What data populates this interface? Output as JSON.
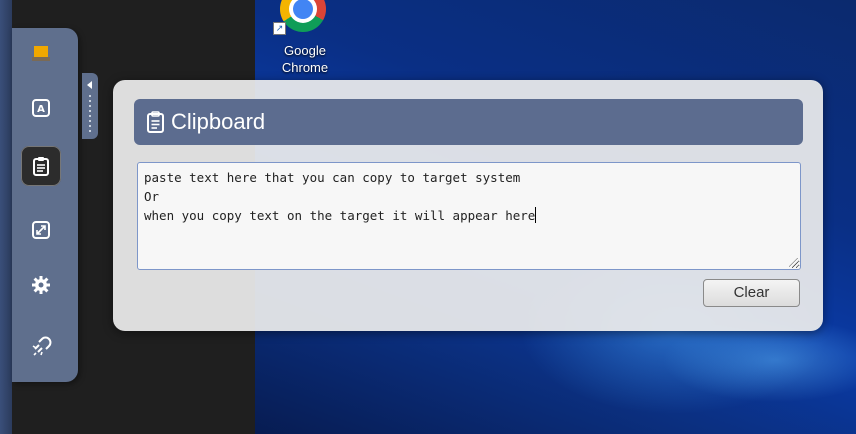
{
  "desktop": {
    "icon_label": "Google\nChrome",
    "icon": "chrome-icon"
  },
  "sidebar": {
    "items": [
      {
        "name": "monitor-icon",
        "active": false
      },
      {
        "name": "keyboard-a-icon",
        "active": false
      },
      {
        "name": "clipboard-icon",
        "active": true
      },
      {
        "name": "fullscreen-icon",
        "active": false
      },
      {
        "name": "gear-icon",
        "active": false
      },
      {
        "name": "disconnect-icon",
        "active": false
      }
    ]
  },
  "clipboard": {
    "title": "Clipboard",
    "text_line1": "paste text here that you can copy to target system",
    "text_line2": "Or",
    "text_line3": "when you copy text on the target it will appear here",
    "clear_label": "Clear"
  },
  "colors": {
    "sidebar": "#5f6f8d",
    "header": "#5c6c8f",
    "panel": "#ececec",
    "desktop": "#0a3aa5"
  }
}
